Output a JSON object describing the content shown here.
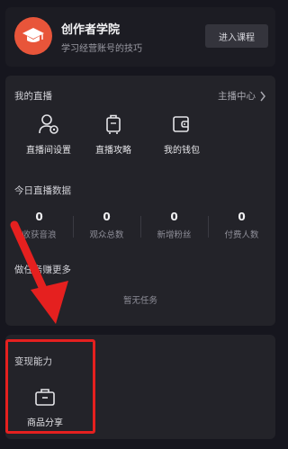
{
  "academy": {
    "title": "创作者学院",
    "subtitle": "学习经营账号的技巧",
    "enter_label": "进入课程"
  },
  "live": {
    "title": "我的直播",
    "host_center": "主播中心",
    "actions": [
      {
        "label": "直播间设置",
        "icon": "user-settings-icon"
      },
      {
        "label": "直播攻略",
        "icon": "suitcase-icon"
      },
      {
        "label": "我的钱包",
        "icon": "wallet-icon"
      }
    ],
    "today_title": "今日直播数据",
    "stats": [
      {
        "value": "0",
        "label": "收获音浪"
      },
      {
        "value": "0",
        "label": "观众总数"
      },
      {
        "value": "0",
        "label": "新增粉丝"
      },
      {
        "value": "0",
        "label": "付费人数"
      }
    ],
    "tasks_title": "做任务赚更多",
    "no_task": "暂无任务"
  },
  "monetization": {
    "title": "变现能力",
    "items": [
      {
        "label": "商品分享",
        "icon": "briefcase-icon"
      }
    ]
  },
  "colors": {
    "background": "#16161e",
    "card": "#232329",
    "accent": "#e8553a",
    "highlight": "#e5201f"
  }
}
